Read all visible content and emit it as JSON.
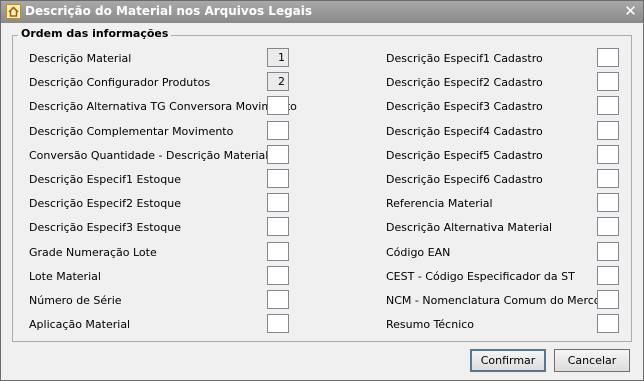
{
  "window": {
    "title": "Descrição do Material nos Arquivos Legais",
    "close_symbol": "✕"
  },
  "group": {
    "title": "Ordem das informações"
  },
  "left_items": [
    {
      "label": "Descrição Material",
      "value": "1"
    },
    {
      "label": "Descrição Configurador Produtos",
      "value": "2"
    },
    {
      "label": "Descrição Alternativa TG Conversora Movimento",
      "value": ""
    },
    {
      "label": "Descrição Complementar Movimento",
      "value": ""
    },
    {
      "label": "Conversão Quantidade -  Descrição Material Pai",
      "value": ""
    },
    {
      "label": "Descrição Especif1 Estoque",
      "value": ""
    },
    {
      "label": "Descrição Especif2 Estoque",
      "value": ""
    },
    {
      "label": "Descrição Especif3 Estoque",
      "value": ""
    },
    {
      "label": "Grade Numeração Lote",
      "value": ""
    },
    {
      "label": "Lote Material",
      "value": ""
    },
    {
      "label": "Número de Série",
      "value": ""
    },
    {
      "label": "Aplicação Material",
      "value": ""
    }
  ],
  "right_items": [
    {
      "label": "Descrição Especif1 Cadastro",
      "value": ""
    },
    {
      "label": "Descrição Especif2 Cadastro",
      "value": ""
    },
    {
      "label": "Descrição Especif3 Cadastro",
      "value": ""
    },
    {
      "label": "Descrição Especif4 Cadastro",
      "value": ""
    },
    {
      "label": "Descrição Especif5 Cadastro",
      "value": ""
    },
    {
      "label": "Descrição Especif6 Cadastro",
      "value": ""
    },
    {
      "label": "Referencia Material",
      "value": ""
    },
    {
      "label": "Descrição Alternativa Material",
      "value": ""
    },
    {
      "label": "Código EAN",
      "value": ""
    },
    {
      "label": "CEST - Código Especificador da ST",
      "value": ""
    },
    {
      "label": "NCM - Nomenclatura Comum do Mercosul",
      "value": ""
    },
    {
      "label": "Resumo Técnico",
      "value": ""
    }
  ],
  "buttons": {
    "confirm": "Confirmar",
    "cancel": "Cancelar"
  }
}
